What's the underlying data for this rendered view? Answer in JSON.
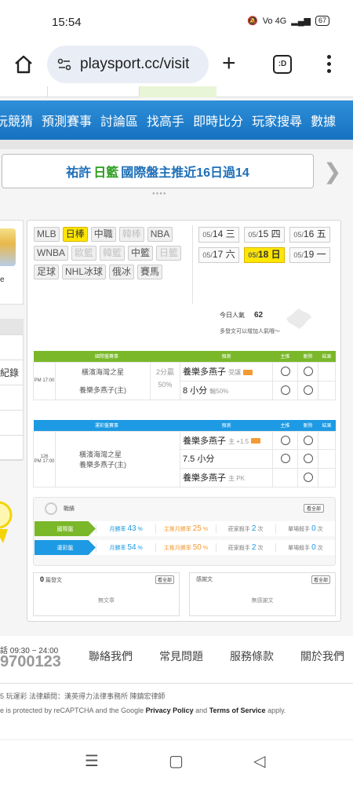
{
  "status_bar": {
    "time": "15:54",
    "net": "Vo 4G",
    "battery": "67"
  },
  "browser": {
    "url": "playsport.cc/visit",
    "tabs_label": ":D"
  },
  "nav": [
    "玩競猜",
    "預測賽事",
    "討論區",
    "找高手",
    "即時比分",
    "玩家搜尋",
    "數據"
  ],
  "announcement": {
    "part1": "祐許",
    "part2": "日籃",
    "part3": "國際盤主推近16日過14"
  },
  "left": {
    "e_char": "e",
    "menu_item": "紀錄"
  },
  "leagues": [
    {
      "label": "MLB",
      "state": "normal"
    },
    {
      "label": "日棒",
      "state": "active"
    },
    {
      "label": "中職",
      "state": "normal"
    },
    {
      "label": "韓棒",
      "state": "disabled"
    },
    {
      "label": "NBA",
      "state": "normal"
    },
    {
      "label": "WNBA",
      "state": "normal"
    },
    {
      "label": "歐籃",
      "state": "disabled"
    },
    {
      "label": "韓籃",
      "state": "disabled"
    },
    {
      "label": "中籃",
      "state": "normal"
    },
    {
      "label": "日籃",
      "state": "disabled"
    },
    {
      "label": "足球",
      "state": "normal"
    },
    {
      "label": "NHL冰球",
      "state": "normal"
    },
    {
      "label": "俄冰",
      "state": "normal"
    },
    {
      "label": "賽馬",
      "state": "normal"
    }
  ],
  "dates": [
    {
      "month": "05/",
      "day": "14",
      "wd": "三",
      "active": false
    },
    {
      "month": "05/",
      "day": "15",
      "wd": "四",
      "active": false
    },
    {
      "month": "05/",
      "day": "16",
      "wd": "五",
      "active": false
    },
    {
      "month": "05/",
      "day": "17",
      "wd": "六",
      "active": false
    },
    {
      "month": "05/",
      "day": "18",
      "wd": "日",
      "active": true
    },
    {
      "month": "05/",
      "day": "19",
      "wd": "一",
      "active": false
    }
  ],
  "popularity": {
    "label": "今日人氣",
    "value": "62",
    "hint": "多發文可以增加人氣哦～"
  },
  "intl_table": {
    "header": [
      "國際盤賽事",
      "預測",
      "主推",
      "刪除",
      "結果"
    ],
    "time": "PM 17:00",
    "away": "橫濱海灣之星",
    "home": "養樂多燕子(主)",
    "line1": "2分贏",
    "line2": "50%",
    "pred1": "養樂多燕子",
    "pred1_note": "受讓",
    "pred2": "8 小分",
    "pred2_note": "輸50%"
  },
  "tw_table": {
    "header": [
      "運彩盤賽事",
      "預測",
      "主推",
      "刪除",
      "結果"
    ],
    "num": "126",
    "time": "PM 17:00",
    "away": "橫濱海灣之星",
    "home": "養樂多燕子(主)",
    "pred1": "養樂多燕子",
    "pred1_note": "主 +1.5",
    "pred2": "7.5 小分",
    "pred3": "養樂多燕子",
    "pred3_note": "主 PK"
  },
  "stats": {
    "title": "戰績",
    "see_all": "看全部",
    "rows": [
      {
        "label": "國際盤",
        "color": "#7ab82a",
        "month_rate": "43",
        "top_rate": "25",
        "streak": "2",
        "single": "0"
      },
      {
        "label": "運彩盤",
        "color": "#1d9ae3",
        "month_rate": "54",
        "top_rate": "50",
        "streak": "2",
        "single": "0"
      }
    ],
    "labels": {
      "month": "月勝率",
      "top": "主推月勝率",
      "streak": "莊家殺手",
      "single": "單場殺手",
      "unit": "次",
      "pct": "%"
    }
  },
  "posts": {
    "count": "0",
    "label": "篇發文",
    "see_all": "看全部",
    "empty": "無文章"
  },
  "thanks": {
    "label": "感謝文",
    "see_all": "看全部",
    "empty": "無感謝文"
  },
  "footer": {
    "hours": "話 09:30 ~ 24:00",
    "phone": "9700123",
    "links": [
      "聯絡我們",
      "常見問題",
      "服務條款",
      "關於我們"
    ],
    "legal": "5 玩運彩 法律顧問：漢英得力法律事務所 陳鎮宏律師",
    "captcha_prefix": "e is protected by reCAPTCHA and the Google ",
    "privacy": "Privacy Policy",
    "and": " and ",
    "terms": "Terms of Service",
    "apply": " apply."
  },
  "colors": {
    "nav_blue": "#1672c1",
    "intl_green": "#7ab82a",
    "tw_blue": "#1d9ae3",
    "active_yellow": "#ffe600"
  }
}
